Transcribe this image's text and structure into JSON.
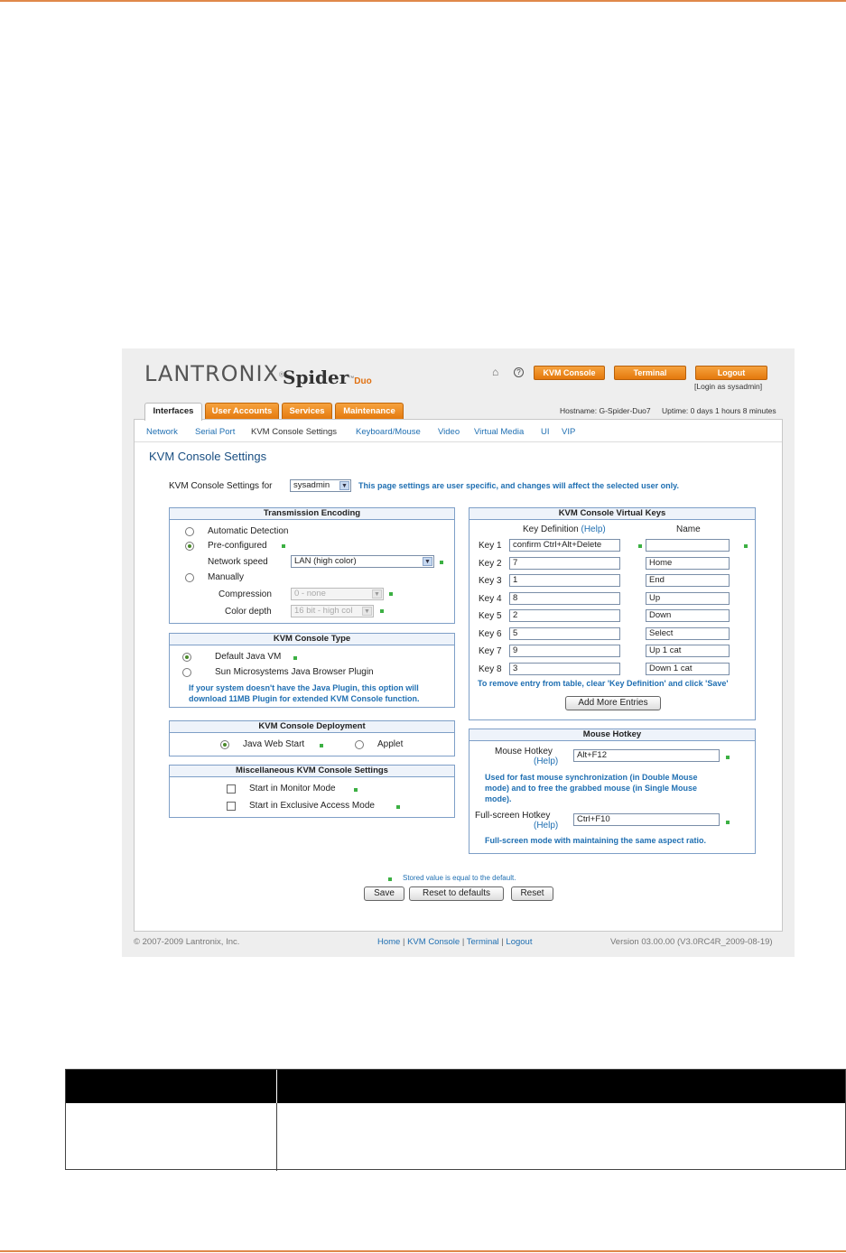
{
  "logo": {
    "brand": "LANTRONIX",
    "brand_suffix": "®",
    "product": "Spider",
    "product_tm": "™",
    "product_suffix": "Duo"
  },
  "header": {
    "kvm_console": "KVM Console",
    "terminal": "Terminal",
    "logout": "Logout",
    "login_as": "[Login as sysadmin]"
  },
  "tabs": [
    "Interfaces",
    "User Accounts",
    "Services",
    "Maintenance"
  ],
  "status": {
    "hostname": "Hostname: G-Spider-Duo7",
    "uptime": "Uptime: 0 days 1 hours 8 minutes"
  },
  "subnav": [
    "Network",
    "Serial Port",
    "KVM Console Settings",
    "Keyboard/Mouse",
    "Video",
    "Virtual Media",
    "UI",
    "VIP"
  ],
  "page_title": "KVM Console Settings",
  "user_row": {
    "label": "KVM Console Settings for",
    "user": "sysadmin",
    "note": "This page settings are user specific, and changes will affect the selected user only."
  },
  "transmission": {
    "title": "Transmission Encoding",
    "auto": "Automatic Detection",
    "preconf": "Pre-configured",
    "net_speed_label": "Network speed",
    "net_speed": "LAN (high color)",
    "manual": "Manually",
    "compression_label": "Compression",
    "compression": "0 - none",
    "color_depth_label": "Color depth",
    "color_depth": "16 bit - high col"
  },
  "console_type": {
    "title": "KVM Console Type",
    "default_vm": "Default Java VM",
    "sun_plugin": "Sun Microsystems Java Browser Plugin",
    "note1": "If your system doesn't have the Java Plugin, this option will",
    "note2": "download 11MB Plugin for extended KVM Console function."
  },
  "deployment": {
    "title": "KVM Console Deployment",
    "webstart": "Java Web Start",
    "applet": "Applet"
  },
  "misc": {
    "title": "Miscellaneous KVM Console Settings",
    "monitor": "Start in Monitor Mode",
    "exclusive": "Start in Exclusive Access Mode"
  },
  "vkeys": {
    "title": "KVM Console Virtual Keys",
    "col_def": "Key Definition",
    "col_help": "(Help)",
    "col_name": "Name",
    "rows": [
      {
        "label": "Key 1",
        "def": "confirm Ctrl+Alt+Delete",
        "name": ""
      },
      {
        "label": "Key 2",
        "def": "7",
        "name": "Home"
      },
      {
        "label": "Key 3",
        "def": "1",
        "name": "End"
      },
      {
        "label": "Key 4",
        "def": "8",
        "name": "Up"
      },
      {
        "label": "Key 5",
        "def": "2",
        "name": "Down"
      },
      {
        "label": "Key 6",
        "def": "5",
        "name": "Select"
      },
      {
        "label": "Key 7",
        "def": "9",
        "name": "Up 1 cat"
      },
      {
        "label": "Key 8",
        "def": "3",
        "name": "Down 1 cat"
      }
    ],
    "note": "To remove entry from table, clear 'Key Definition' and click 'Save'",
    "add_more": "Add More Entries"
  },
  "mouse": {
    "title": "Mouse Hotkey",
    "hotkey_label": "Mouse Hotkey",
    "help": "(Help)",
    "hotkey": "Alt+F12",
    "note1": "Used for fast mouse synchronization (in Double Mouse",
    "note2": "mode) and to free the grabbed mouse (in Single Mouse",
    "note3": "mode).",
    "fs_label": "Full-screen Hotkey",
    "fs_help": "(Help)",
    "fs_hotkey": "Ctrl+F10",
    "fs_note": "Full-screen mode with maintaining the same aspect ratio."
  },
  "legend": "Stored value is equal to the default.",
  "buttons": {
    "save": "Save",
    "reset_defaults": "Reset to defaults",
    "reset": "Reset"
  },
  "footer": {
    "copyright": "© 2007-2009 Lantronix, Inc.",
    "home": "Home",
    "kvm": "KVM Console",
    "terminal": "Terminal",
    "logout": "Logout",
    "sep": "|",
    "version": "Version 03.00.00 (V3.0RC4R_2009-08-19)"
  },
  "colors": {
    "accent": "#e4780c",
    "link": "#1f6fb2",
    "default_marker": "#3cb043",
    "rule": "#e0884a"
  }
}
